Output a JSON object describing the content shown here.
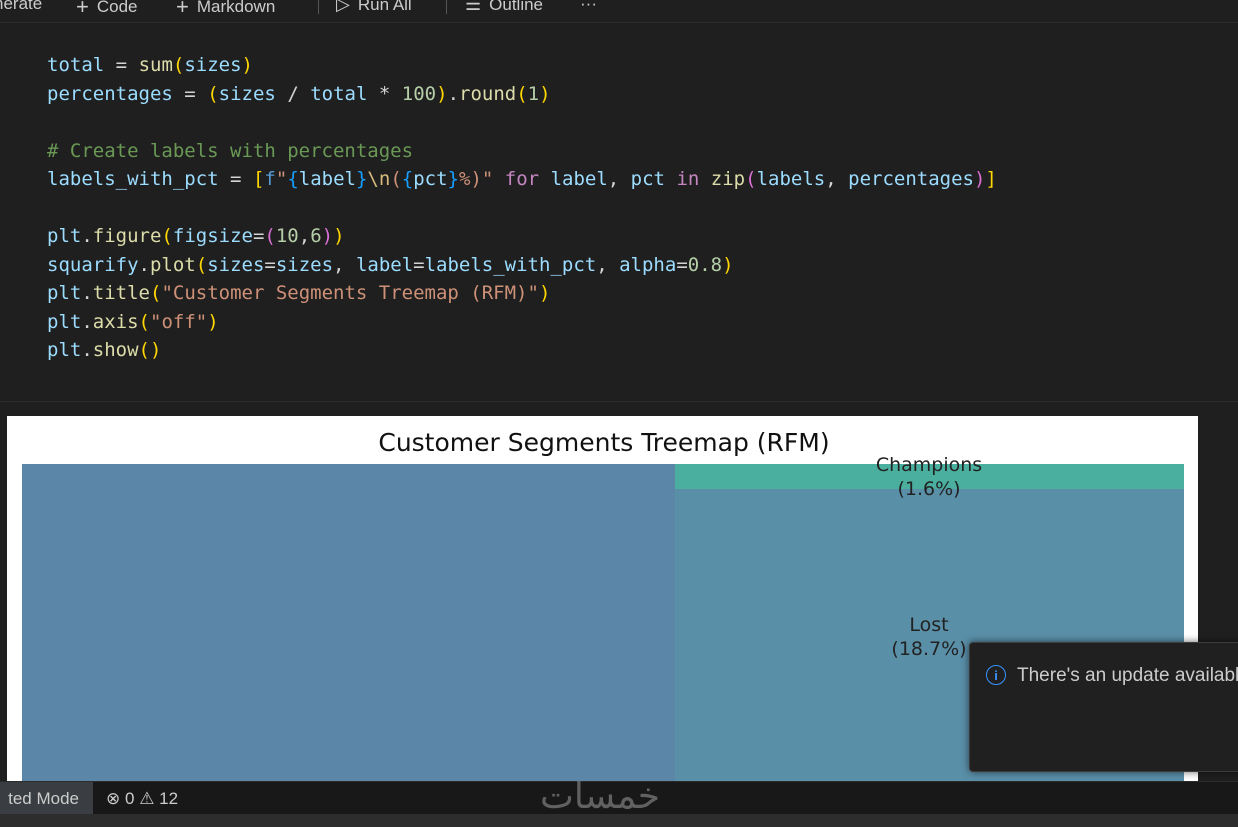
{
  "toolbar": {
    "generate_label": "nerate",
    "code_label": "Code",
    "markdown_label": "Markdown",
    "run_all_label": "Run All",
    "outline_label": "Outline",
    "more_label": "···"
  },
  "code_lines": [
    "total = sum(sizes)",
    "percentages = (sizes / total * 100).round(1)",
    "",
    "# Create labels with percentages",
    "labels_with_pct = [f\"{label}\\n({pct}%)\" for label, pct in zip(labels, percentages)]",
    "",
    "plt.figure(figsize=(10,6))",
    "squarify.plot(sizes=sizes, label=labels_with_pct, alpha=0.8)",
    "plt.title(\"Customer Segments Treemap (RFM)\")",
    "plt.axis(\"off\")",
    "plt.show()"
  ],
  "chart_data": {
    "type": "treemap",
    "title": "Customer Segments Treemap (RFM)",
    "segments": [
      {
        "label": "Champions",
        "pct_label": "(1.6%)",
        "value": 1.6,
        "color": "#4aaf9e"
      },
      {
        "label": "Lost",
        "pct_label": "(18.7%)",
        "value": 18.7,
        "color": "#5a8fa8"
      },
      {
        "label": "",
        "pct_label": "",
        "value": 56.5,
        "color": "#5b86a8"
      }
    ]
  },
  "statusbar": {
    "mode_label": "ted Mode",
    "errors": "0",
    "warnings": "12"
  },
  "watermark": "خمسات",
  "toast": {
    "message": "There's an update availabl"
  },
  "colors": {
    "editor_bg": "#1f1f1f",
    "accent_info": "#3794ff"
  }
}
